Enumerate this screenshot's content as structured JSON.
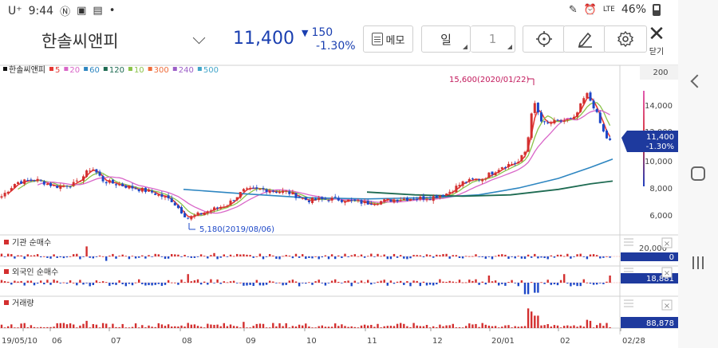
{
  "status_bar": {
    "carrier": "U⁺",
    "time": "9:44",
    "left_icons": [
      "data-saver-icon",
      "gallery-icon",
      "notification-icon",
      "dot-icon"
    ],
    "right_icons": [
      "edit-icon",
      "alarm-icon",
      "lte-signal-icon",
      "battery-icon"
    ],
    "lte": "LTE",
    "battery": "46%"
  },
  "header": {
    "stock_name": "한솔씨앤피",
    "price": "11,400",
    "change_arrow": "▼",
    "change_value": "150",
    "change_percent": "-1.30%",
    "memo_label": "메모",
    "period_label": "일",
    "period_count": "1",
    "crosshair_icon": "crosshair-icon",
    "draw_icon": "pen-icon",
    "settings_icon": "gear-icon",
    "close_label": "닫기"
  },
  "legend": [
    {
      "label": "한솔씨앤피",
      "color": "#111111"
    },
    {
      "label": "5",
      "color": "#e53935"
    },
    {
      "label": "20",
      "color": "#d966c8"
    },
    {
      "label": "60",
      "color": "#2e86c1"
    },
    {
      "label": "120",
      "color": "#1e6b52"
    },
    {
      "label": "10",
      "color": "#8bc34a"
    },
    {
      "label": "300",
      "color": "#ef6c3a"
    },
    {
      "label": "240",
      "color": "#9c5fc8"
    },
    {
      "label": "500",
      "color": "#42a5c9"
    }
  ],
  "price_axis": {
    "top_value": "200",
    "ticks": [
      "14,000",
      "12,000",
      "10,000",
      "8,000",
      "6,000"
    ],
    "current_label": "11,400",
    "current_change": "-1.30%"
  },
  "annotations": {
    "high": "15,600(2020/01/22)",
    "low": "5,180(2019/08/06)"
  },
  "panels": {
    "institution": {
      "title": "기관 순매수",
      "axis_top": "20,000",
      "value": "0"
    },
    "foreign": {
      "title": "외국인 순매수",
      "value": "18,881"
    },
    "volume": {
      "title": "거래량",
      "value": "88,878"
    }
  },
  "x_axis": [
    "19/05/10",
    "06",
    "07",
    "08",
    "09",
    "10",
    "11",
    "12",
    "20/01",
    "02",
    "02/28"
  ],
  "colors": {
    "up": "#d32f2f",
    "down": "#1e48c8",
    "price_accent": "#1a3fb0",
    "label_bg": "#1e3a9e"
  }
}
